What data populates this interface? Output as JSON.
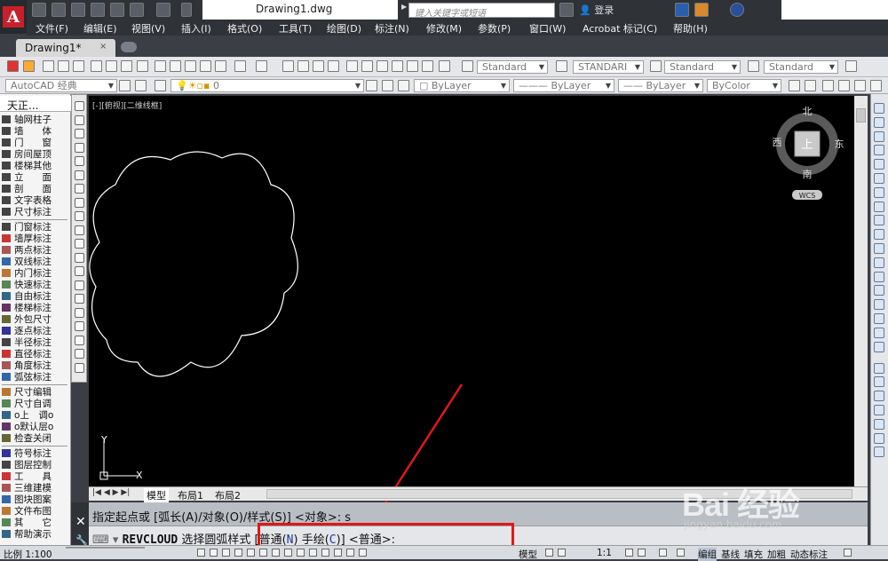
{
  "titlebar": {
    "document_title": "Drawing1.dwg",
    "search_placeholder": "键入关键字或短语",
    "login_label": "登录"
  },
  "menubar": {
    "items": [
      "文件(F)",
      "编辑(E)",
      "视图(V)",
      "插入(I)",
      "格式(O)",
      "工具(T)",
      "绘图(D)",
      "标注(N)",
      "修改(M)",
      "参数(P)",
      "窗口(W)",
      "Acrobat 标记(C)",
      "帮助(H)"
    ]
  },
  "doc_tab": {
    "label": "Drawing1*",
    "close": "×"
  },
  "toolbar1": {
    "text_style": "Standard",
    "dim_style": "STANDARI",
    "table_style": "Standard",
    "mleader_style": "Standard"
  },
  "toolbar2": {
    "workspace": "AutoCAD 经典",
    "layer": "0",
    "color": "ByLayer",
    "linetype": "ByLayer",
    "lineweight": "ByLayer",
    "plotstyle": "ByColor"
  },
  "tangent_panel": {
    "header": "天正...",
    "items": [
      "轴网柱子",
      "墙　　体",
      "门　　窗",
      "房间屋顶",
      "楼梯其他",
      "立　　面",
      "剖　　面",
      "文字表格",
      "尺寸标注",
      "门窗标注",
      "墙厚标注",
      "两点标注",
      "双线标注",
      "内门标注",
      "快速标注",
      "自由标注",
      "楼梯标注",
      "外包尺寸",
      "逐点标注",
      "半径标注",
      "直径标注",
      "角度标注",
      "弧弦标注",
      "尺寸编辑",
      "尺寸自调",
      "o上　调o",
      "o默认层o",
      "检查关闭",
      "符号标注",
      "图层控制",
      "工　　具",
      "三维建模",
      "图块图案",
      "文件布图",
      "其　　它",
      "帮助演示"
    ]
  },
  "canvas": {
    "viewport_label": "[-][俯视][二维线框]",
    "viewcube": {
      "north": "北",
      "south": "南",
      "east": "东",
      "west": "西",
      "top": "上",
      "wcs": "WCS"
    },
    "ucs_x": "X",
    "ucs_y": "Y"
  },
  "layout_tabs": [
    "模型",
    "布局1",
    "布局2"
  ],
  "command": {
    "history": "指定起点或 [弧长(A)/对象(O)/样式(S)] <对象>: s",
    "command_name": "REVCLOUD",
    "prompt": "选择圆弧样式",
    "bracket_open": "[",
    "opt_normal": "普通(",
    "opt_normal_key": "N",
    "opt_normal_close": ")",
    "opt_freehand": "手绘(",
    "opt_freehand_key": "C",
    "opt_freehand_close": ")",
    "bracket_close": "]",
    "default": "<普通>:"
  },
  "statusbar": {
    "scale": "比例 1:100",
    "model": "模型",
    "annotation_scale": "1:1",
    "items": [
      "编组",
      "基线",
      "填充",
      "加粗",
      "动态标注"
    ]
  },
  "watermark": {
    "logo": "Bai 经验",
    "url": "jingyan.baidu.com"
  },
  "colors": {
    "canvas_bg": "#000000",
    "highlight": "#e01818",
    "cloud_stroke": "#ffffff",
    "arrow": "#e01818"
  }
}
